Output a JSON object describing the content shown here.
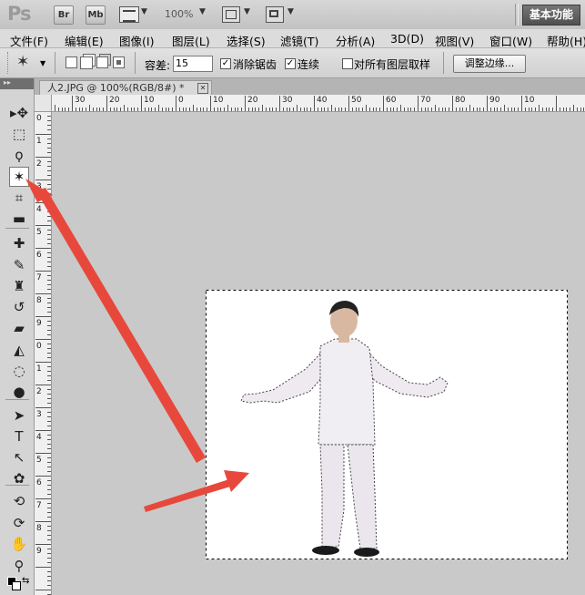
{
  "app": {
    "logo": "Ps",
    "bridge": "Br",
    "minibridge": "Mb",
    "zoom": "100%",
    "workspace": "基本功能"
  },
  "menu": [
    "文件(F)",
    "编辑(E)",
    "图像(I)",
    "图层(L)",
    "选择(S)",
    "滤镜(T)",
    "分析(A)",
    "3D(D)",
    "视图(V)",
    "窗口(W)",
    "帮助(H)"
  ],
  "options": {
    "tolerance_label": "容差:",
    "tolerance_value": "15",
    "anti_alias_label": "消除锯齿",
    "anti_alias_checked": true,
    "contiguous_label": "连续",
    "contiguous_checked": true,
    "sample_all_label": "对所有图层取样",
    "sample_all_checked": false,
    "refine_edge": "调整边缘..."
  },
  "document": {
    "tab_title": "人2.JPG @ 100%(RGB/8#) *",
    "close": "✕"
  },
  "ruler_top_labels": [
    "40",
    "30",
    "20",
    "10",
    "0",
    "10",
    "20",
    "30",
    "40",
    "50",
    "60",
    "70",
    "80",
    "90",
    "10"
  ],
  "ruler_left_labels": [
    "0",
    "1",
    "2",
    "3",
    "4",
    "5",
    "6",
    "7",
    "8",
    "9",
    "0",
    "1",
    "2",
    "3",
    "4",
    "5",
    "6",
    "7",
    "8",
    "9"
  ],
  "tools": [
    {
      "name": "move-tool",
      "glyph": "▸✥"
    },
    {
      "name": "marquee-tool",
      "glyph": "⬚"
    },
    {
      "name": "lasso-tool",
      "glyph": "ϙ"
    },
    {
      "name": "magic-wand-tool",
      "glyph": "✶"
    },
    {
      "name": "crop-tool",
      "glyph": "⌗"
    },
    {
      "name": "ruler-tool",
      "glyph": "▬"
    },
    {
      "name": "healing-brush-tool",
      "glyph": "✚"
    },
    {
      "name": "brush-tool",
      "glyph": "✎"
    },
    {
      "name": "stamp-tool",
      "glyph": "♜"
    },
    {
      "name": "history-brush-tool",
      "glyph": "↺"
    },
    {
      "name": "eraser-tool",
      "glyph": "▰"
    },
    {
      "name": "paint-bucket-tool",
      "glyph": "◭"
    },
    {
      "name": "blur-tool",
      "glyph": "◌"
    },
    {
      "name": "dodge-tool",
      "glyph": "●"
    },
    {
      "name": "pen-tool",
      "glyph": "➤"
    },
    {
      "name": "type-tool",
      "glyph": "T"
    },
    {
      "name": "path-select-tool",
      "glyph": "↖"
    },
    {
      "name": "shape-tool",
      "glyph": "✿"
    },
    {
      "name": "3d-rotate-tool",
      "glyph": "⟲"
    },
    {
      "name": "3d-orbit-tool",
      "glyph": "⟳"
    },
    {
      "name": "hand-tool",
      "glyph": "✋"
    },
    {
      "name": "zoom-tool",
      "glyph": "⚲"
    }
  ],
  "colors": {
    "arrow": "#e8483c",
    "canvas": "#ffffff",
    "workspace_bg": "#c9c9c9"
  }
}
